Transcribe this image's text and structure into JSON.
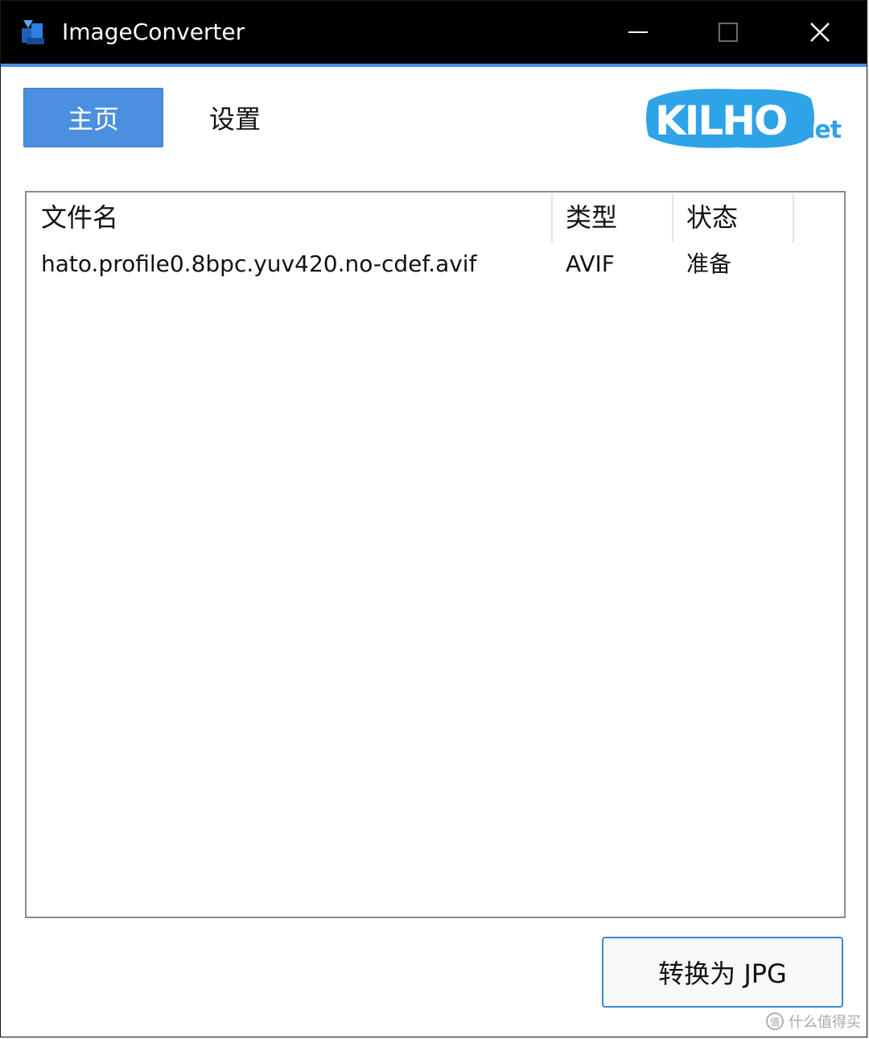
{
  "window": {
    "title": "ImageConverter",
    "controls": {
      "minimize": "minimize-icon",
      "maximize": "maximize-icon",
      "close": "close-icon"
    }
  },
  "tabs": [
    {
      "label": "主页",
      "active": true
    },
    {
      "label": "设置",
      "active": false
    }
  ],
  "logo": {
    "text": "KILHO",
    "suffix": "net",
    "color": "#2ea3e8"
  },
  "file_list": {
    "columns": [
      "文件名",
      "类型",
      "状态"
    ],
    "rows": [
      {
        "filename": "hato.profile0.8bpc.yuv420.no-cdef.avif",
        "type": "AVIF",
        "status": "准备"
      }
    ]
  },
  "actions": {
    "convert_label": "转换为 JPG"
  },
  "watermark": {
    "text": "什么值得买",
    "icon_text": "值"
  },
  "colors": {
    "accent": "#4a8fe0",
    "titlebar": "#000000",
    "logo": "#2ea3e8"
  }
}
